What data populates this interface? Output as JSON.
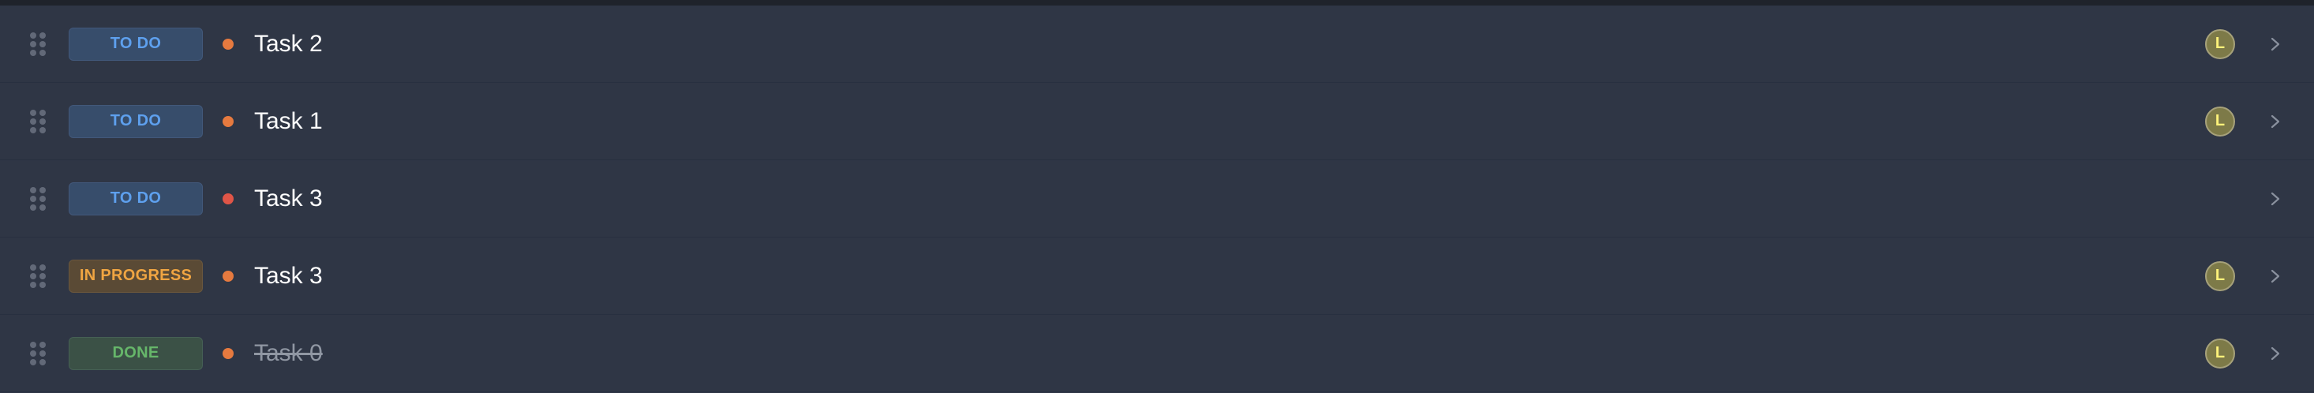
{
  "colors": {
    "background": "#2f3645",
    "top_bar": "#1f232b",
    "orange_dot": "#e67a3f",
    "red_dot": "#e05547"
  },
  "tasks": [
    {
      "status_label": "TO DO",
      "status_type": "todo",
      "title": "Task 2",
      "priority_color": "#e67a3f",
      "assignee_initial": "L",
      "has_assignee": true,
      "completed": false,
      "icons": [
        "drag-handle-icon",
        "chevron-right-icon"
      ]
    },
    {
      "status_label": "TO DO",
      "status_type": "todo",
      "title": "Task 1",
      "priority_color": "#e67a3f",
      "assignee_initial": "L",
      "has_assignee": true,
      "completed": false,
      "icons": [
        "drag-handle-icon",
        "chevron-right-icon"
      ]
    },
    {
      "status_label": "TO DO",
      "status_type": "todo",
      "title": "Task 3",
      "priority_color": "#e05547",
      "assignee_initial": "",
      "has_assignee": false,
      "completed": false,
      "icons": [
        "drag-handle-icon",
        "chevron-right-icon"
      ]
    },
    {
      "status_label": "IN PROGRESS",
      "status_type": "inprogress",
      "title": "Task 3",
      "priority_color": "#e67a3f",
      "assignee_initial": "L",
      "has_assignee": true,
      "completed": false,
      "icons": [
        "drag-handle-icon",
        "chevron-right-icon"
      ]
    },
    {
      "status_label": "DONE",
      "status_type": "done",
      "title": "Task 0",
      "priority_color": "#e67a3f",
      "assignee_initial": "L",
      "has_assignee": true,
      "completed": true,
      "icons": [
        "drag-handle-icon",
        "chevron-right-icon"
      ]
    }
  ]
}
